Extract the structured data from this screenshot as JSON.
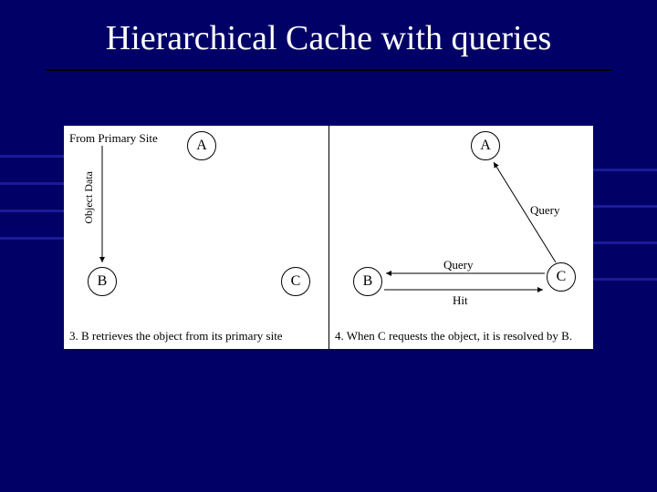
{
  "slide": {
    "title": "Hierarchical Cache with queries"
  },
  "diagram": {
    "left_panel": {
      "from_primary_label": "From Primary Site",
      "object_data_label": "Object Data",
      "node_a": "A",
      "node_b": "B",
      "node_c": "C",
      "caption": "3. B retrieves the object from its primary site"
    },
    "right_panel": {
      "node_a": "A",
      "node_b": "B",
      "node_c": "C",
      "query_label_1": "Query",
      "query_label_2": "Query",
      "hit_label": "Hit",
      "caption": "4. When C requests the object, it is resolved by B."
    }
  },
  "colors": {
    "background": "#000066",
    "panel_bg": "#ffffff",
    "text": "#000000",
    "title_text": "#ffffff"
  }
}
